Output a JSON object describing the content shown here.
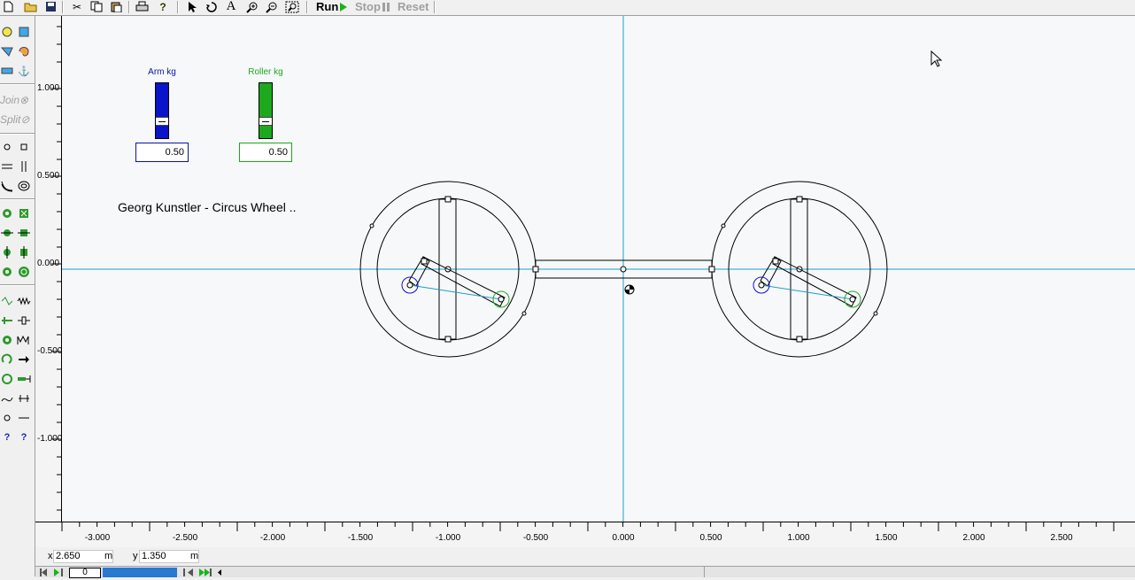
{
  "toolbar": {
    "run_label": "Run",
    "stop_label": "Stop",
    "reset_label": "Reset"
  },
  "palette": {
    "join_label": "Join",
    "split_label": "Split"
  },
  "rulers": {
    "y_ticks": [
      "1.000",
      "0.500",
      "0.000",
      "-0.500",
      "-1.000"
    ],
    "x_ticks": [
      "-3.000",
      "-2.500",
      "-2.000",
      "-1.500",
      "-1.000",
      "-0.500",
      "0.000",
      "0.500",
      "1.000",
      "1.500",
      "2.000",
      "2.500"
    ]
  },
  "controls": {
    "arm": {
      "label": "Arm kg",
      "value": "0.50",
      "level": 0.5,
      "color": "#0a14c8"
    },
    "roller": {
      "label": "Roller kg",
      "value": "0.50",
      "level": 0.5,
      "color": "#1ea81e"
    }
  },
  "scene": {
    "title": "Georg Kunstler - Circus Wheel .."
  },
  "status": {
    "x_label": "x",
    "x_value": "2.650",
    "x_unit": "m",
    "y_label": "y",
    "y_value": "1.350",
    "y_unit": "m"
  },
  "playback": {
    "frame": "0"
  },
  "colors": {
    "axis": "#1e9ec8",
    "canvas": "#f6f8fa"
  }
}
